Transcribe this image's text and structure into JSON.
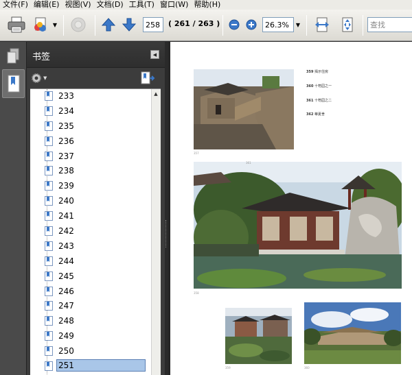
{
  "menu": [
    "文件(F)",
    "编辑(E)",
    "视图(V)",
    "文档(D)",
    "工具(T)",
    "窗口(W)",
    "帮助(H)"
  ],
  "toolbar": {
    "current_page": "258",
    "page_count": "( 261 / 263 )",
    "zoom": "26.3%",
    "search_placeholder": "查找"
  },
  "panel": {
    "title": "书签",
    "bookmarks": [
      "233",
      "234",
      "235",
      "236",
      "237",
      "238",
      "239",
      "240",
      "241",
      "242",
      "243",
      "244",
      "245",
      "246",
      "247",
      "248",
      "249",
      "250",
      "251"
    ],
    "selected": "251"
  },
  "document": {
    "captions": [
      {
        "num": "359",
        "text": "揭示住房"
      },
      {
        "num": "360",
        "text": "十笏园之一"
      },
      {
        "num": "361",
        "text": "十笏园之二"
      },
      {
        "num": "362",
        "text": "蒂夏舍"
      }
    ],
    "photo_numbers": [
      "357",
      "358",
      "359",
      "360",
      "361"
    ]
  },
  "colors": {
    "toolbar_bg": "#dcdad3",
    "panel_bg": "#3c3c3c",
    "selection": "#a9c6e8",
    "accent_blue": "#3b78c8"
  }
}
